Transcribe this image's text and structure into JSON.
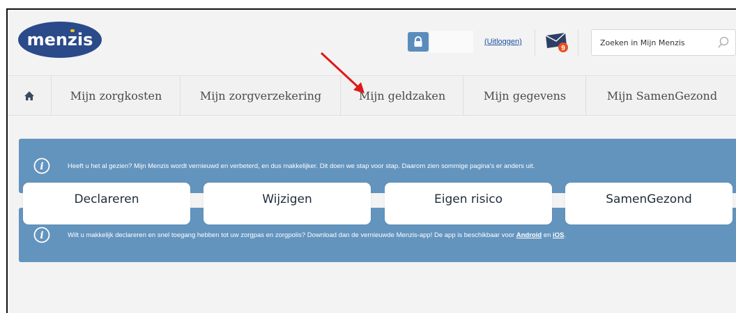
{
  "logo": {
    "text": "menzis"
  },
  "header": {
    "lock_icon": "lock-icon",
    "logout_label": "(Uitloggen)",
    "mail_badge_count": "9",
    "search_placeholder": "Zoeken in Mijn Menzis"
  },
  "nav": {
    "home_icon": "home-icon",
    "items": [
      {
        "label": "Mijn zorgkosten"
      },
      {
        "label": "Mijn zorgverzekering"
      },
      {
        "label": "Mijn geldzaken"
      },
      {
        "label": "Mijn gegevens"
      },
      {
        "label": "Mijn SamenGezond"
      }
    ]
  },
  "notices": [
    {
      "text": "Heeft u het al gezien? Mijn Menzis wordt vernieuwd en verbeterd, en dus makkelijker. Dit doen we stap voor stap. Daarom zien sommige pagina's er anders uit."
    },
    {
      "text_before": "Wilt u makkelijk declareren en snel toegang hebben tot uw zorgpas en zorgpolis? Download dan de vernieuwde Menzis-app! De app is beschikbaar voor ",
      "link_android": "Android",
      "text_middle": " en ",
      "link_ios": "iOS",
      "text_after": "."
    }
  ],
  "cards": [
    {
      "label": "Declareren"
    },
    {
      "label": "Wijzigen"
    },
    {
      "label": "Eigen risico"
    },
    {
      "label": "SamenGezond"
    }
  ],
  "colors": {
    "brand_blue": "#2a4a8a",
    "notice_blue": "#6394be",
    "arrow_red": "#e01818",
    "badge_orange": "#e8501e"
  }
}
